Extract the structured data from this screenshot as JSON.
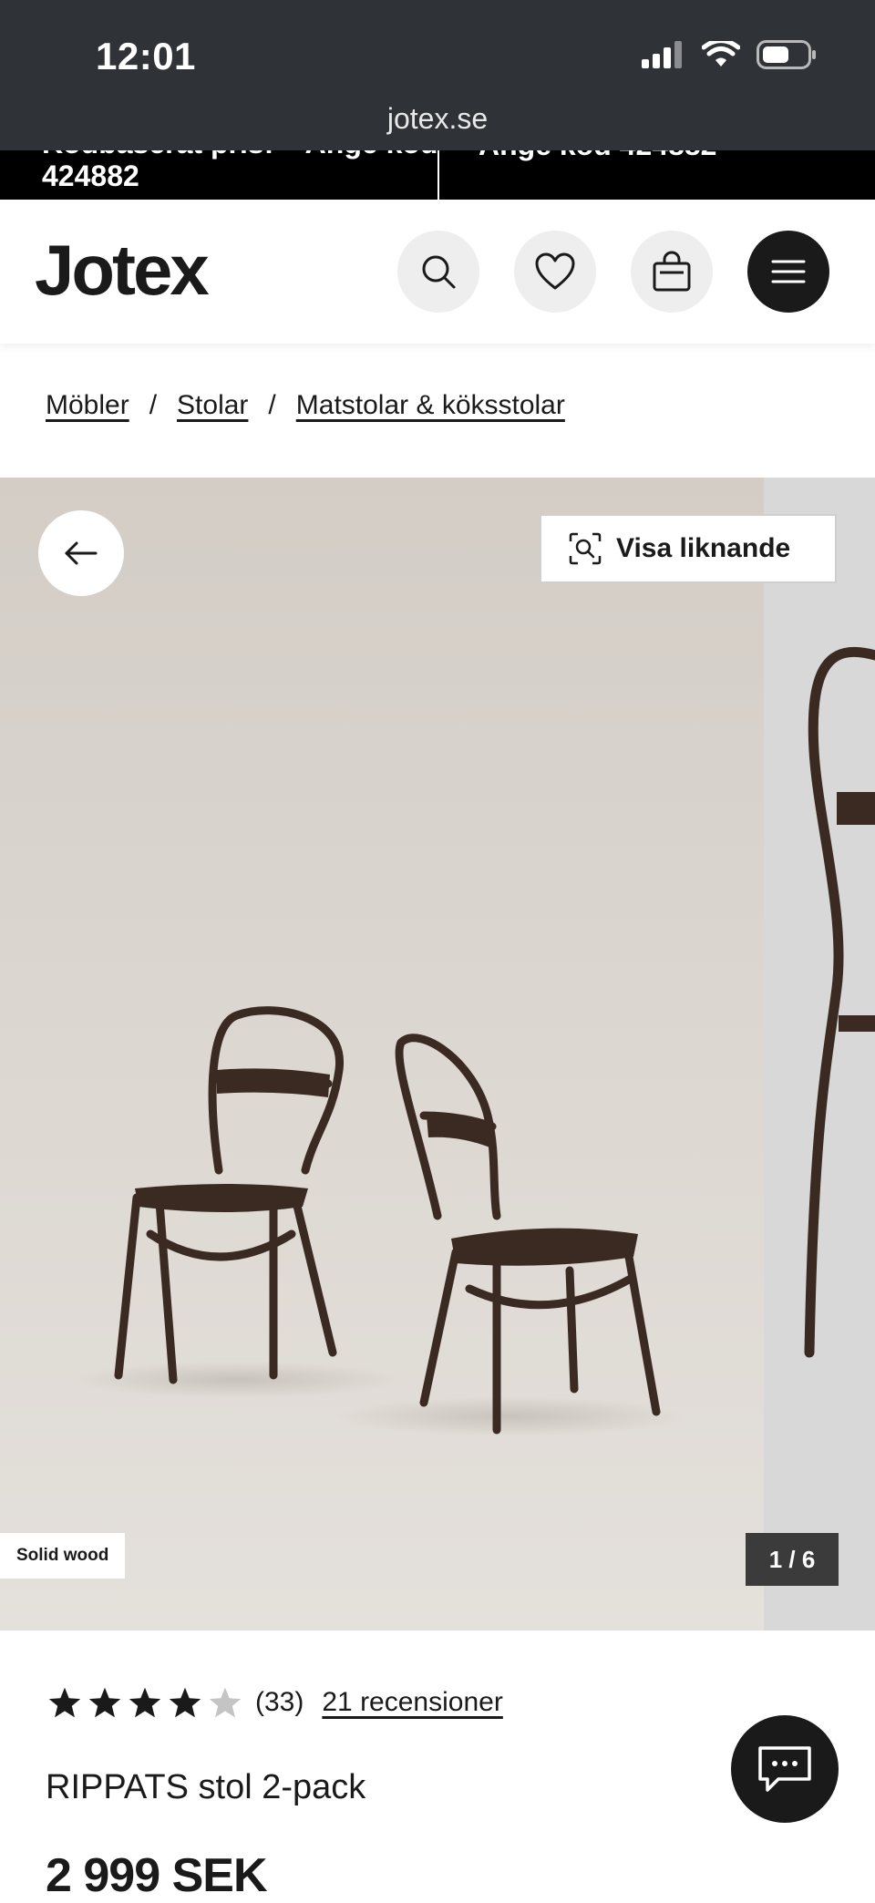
{
  "status_bar": {
    "time": "12:01",
    "url": "jotex.se"
  },
  "promo": {
    "left_partial": "Kodbaserat pris: – Ange kod",
    "left_code": "424882",
    "right_partial": "Ange kod 424882"
  },
  "header": {
    "logo": "Jotex"
  },
  "breadcrumb": {
    "items": [
      "Möbler",
      "Stolar",
      "Matstolar & köksstolar"
    ],
    "separator": "/"
  },
  "gallery": {
    "similar_label": "Visa liknande",
    "tag": "Solid wood",
    "counter": "1 / 6"
  },
  "product": {
    "rating_stars": 4,
    "rating_max": 5,
    "rating_count": "(33)",
    "reviews_link": "21 recensioner",
    "name": "RIPPATS stol 2-pack",
    "price": "2 999 SEK"
  },
  "colors": {
    "status_bar_bg": "#2f3236",
    "promo_bg": "#000000",
    "accent": "#1a1a1a",
    "star": "#1a1a1a",
    "star_empty": "#c4c4c4"
  },
  "icons": [
    "signal-icon",
    "wifi-icon",
    "battery-icon",
    "search-icon",
    "heart-icon",
    "bag-icon",
    "menu-icon",
    "arrow-left-icon",
    "visual-search-icon",
    "chat-icon"
  ]
}
